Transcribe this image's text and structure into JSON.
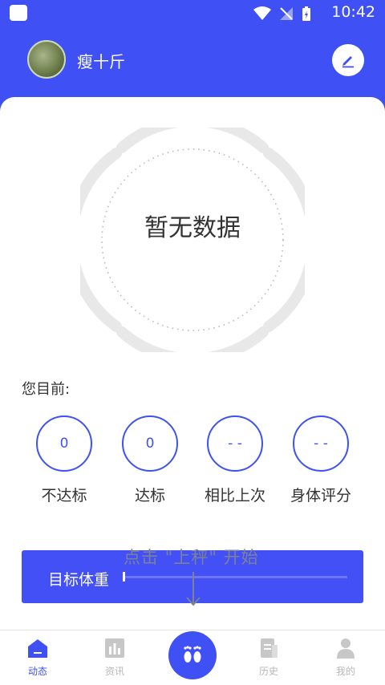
{
  "status_bar": {
    "time": "10:42"
  },
  "header": {
    "username": "瘦十斤"
  },
  "summary": {
    "empty_text": "暂无数据",
    "current_label": "您目前:"
  },
  "stats": [
    {
      "value": "0",
      "label": "不达标"
    },
    {
      "value": "0",
      "label": "达标"
    },
    {
      "value": "- -",
      "label": "相比上次"
    },
    {
      "value": "- -",
      "label": "身体评分"
    }
  ],
  "target": {
    "label": "目标体重",
    "hint": "点击 \"上秤\" 开始"
  },
  "tabs": [
    {
      "label": "动态",
      "icon": "home-icon"
    },
    {
      "label": "资讯",
      "icon": "news-icon"
    },
    {
      "label": "",
      "icon": "footprints-icon"
    },
    {
      "label": "历史",
      "icon": "history-icon"
    },
    {
      "label": "我的",
      "icon": "profile-icon"
    }
  ],
  "colors": {
    "primary": "#3f51f5",
    "inactive": "#b7b7b7"
  }
}
